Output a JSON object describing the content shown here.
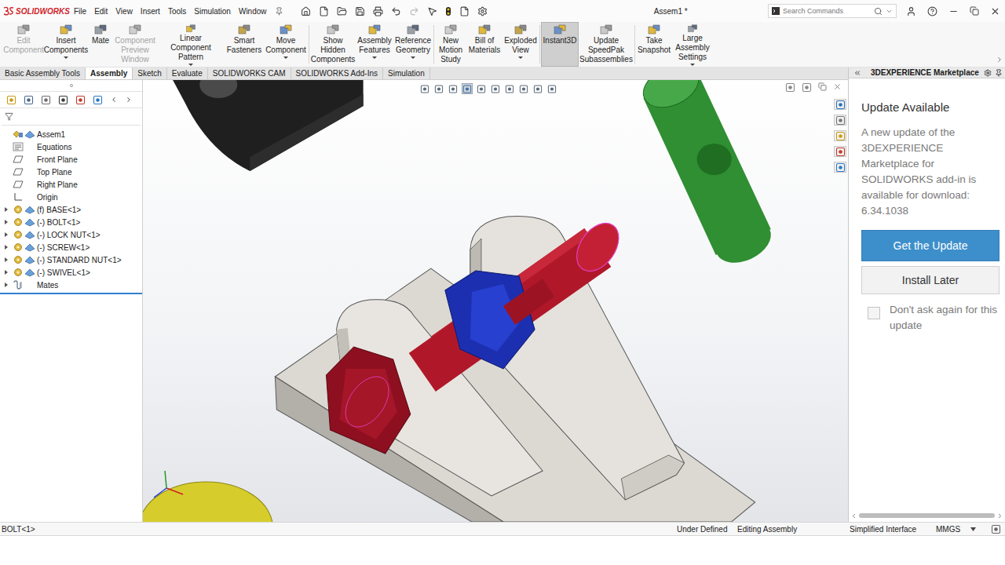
{
  "app": {
    "logo": "SOLIDWORKS"
  },
  "menu": [
    "File",
    "Edit",
    "View",
    "Insert",
    "Tools",
    "Simulation",
    "Window"
  ],
  "window": {
    "title": "Assem1 *"
  },
  "search": {
    "placeholder": "Search Commands"
  },
  "ribbon": [
    {
      "label": "Edit Component",
      "disabled": true,
      "selected": false,
      "dropdown": false
    },
    {
      "label": "Insert Components",
      "disabled": false,
      "selected": false,
      "dropdown": true
    },
    {
      "label": "Mate",
      "disabled": false,
      "selected": false,
      "dropdown": false
    },
    {
      "label": "Component Preview Window",
      "disabled": true,
      "selected": false,
      "dropdown": false
    },
    {
      "label": "Linear Component Pattern",
      "disabled": false,
      "selected": false,
      "dropdown": true
    },
    {
      "label": "Smart Fasteners",
      "disabled": false,
      "selected": false,
      "dropdown": false
    },
    {
      "label": "Move Component",
      "disabled": false,
      "selected": false,
      "dropdown": true
    },
    {
      "label": "Show Hidden Components",
      "disabled": false,
      "selected": false,
      "dropdown": false
    },
    {
      "label": "Assembly Features",
      "disabled": false,
      "selected": false,
      "dropdown": true
    },
    {
      "label": "Reference Geometry",
      "disabled": false,
      "selected": false,
      "dropdown": true
    },
    {
      "label": "New Motion Study",
      "disabled": false,
      "selected": false,
      "dropdown": false
    },
    {
      "label": "Bill of Materials",
      "disabled": false,
      "selected": false,
      "dropdown": false
    },
    {
      "label": "Exploded View",
      "disabled": false,
      "selected": false,
      "dropdown": true
    },
    {
      "label": "Instant3D",
      "disabled": false,
      "selected": true,
      "dropdown": false
    },
    {
      "label": "Update SpeedPak Subassemblies",
      "disabled": false,
      "selected": false,
      "dropdown": false
    },
    {
      "label": "Take Snapshot",
      "disabled": false,
      "selected": false,
      "dropdown": false
    },
    {
      "label": "Large Assembly Settings",
      "disabled": false,
      "selected": false,
      "dropdown": true
    }
  ],
  "tabs": [
    {
      "label": "Basic Assembly Tools",
      "selected": false
    },
    {
      "label": "Assembly",
      "selected": true
    },
    {
      "label": "Sketch",
      "selected": false
    },
    {
      "label": "Evaluate",
      "selected": false
    },
    {
      "label": "SOLIDWORKS CAM",
      "selected": false
    },
    {
      "label": "SOLIDWORKS Add-Ins",
      "selected": false
    },
    {
      "label": "Simulation",
      "selected": false
    }
  ],
  "tree": {
    "items": [
      {
        "label": "Assem1",
        "kind": "assembly",
        "expandable": false,
        "expanded": false
      },
      {
        "label": "Equations",
        "kind": "equations",
        "expandable": false,
        "expanded": false
      },
      {
        "label": "Front Plane",
        "kind": "plane",
        "expandable": false,
        "expanded": false
      },
      {
        "label": "Top Plane",
        "kind": "plane",
        "expandable": false,
        "expanded": false
      },
      {
        "label": "Right Plane",
        "kind": "plane",
        "expandable": false,
        "expanded": false
      },
      {
        "label": "Origin",
        "kind": "origin",
        "expandable": false,
        "expanded": false
      },
      {
        "label": "(f) BASE<1>",
        "kind": "component",
        "expandable": true,
        "expanded": false
      },
      {
        "label": "(-) BOLT<1>",
        "kind": "component",
        "expandable": true,
        "expanded": false
      },
      {
        "label": "(-) LOCK NUT<1>",
        "kind": "component",
        "expandable": true,
        "expanded": false
      },
      {
        "label": "(-) SCREW<1>",
        "kind": "component",
        "expandable": true,
        "expanded": false
      },
      {
        "label": "(-) STANDARD NUT<1>",
        "kind": "component",
        "expandable": true,
        "expanded": false
      },
      {
        "label": "(-) SWIVEL<1>",
        "kind": "component",
        "expandable": true,
        "expanded": false
      },
      {
        "label": "Mates",
        "kind": "mates",
        "expandable": true,
        "expanded": false
      }
    ]
  },
  "taskpane": {
    "title": "3DEXPERIENCE Marketplace",
    "heading": "Update Available",
    "message": "A new update of the 3DEXPERIENCE Marketplace for SOLIDWORKS add-in is available for download: 6.34.1038",
    "primary_button": "Get the Update",
    "secondary_button": "Install Later",
    "checkbox": {
      "label": "Don't ask again for this update",
      "checked": false
    }
  },
  "status_bar": {
    "selection": "BOLT<1>",
    "state": "Under Defined",
    "mode": "Editing Assembly",
    "interface": "Simplified Interface",
    "units": "MMGS"
  }
}
